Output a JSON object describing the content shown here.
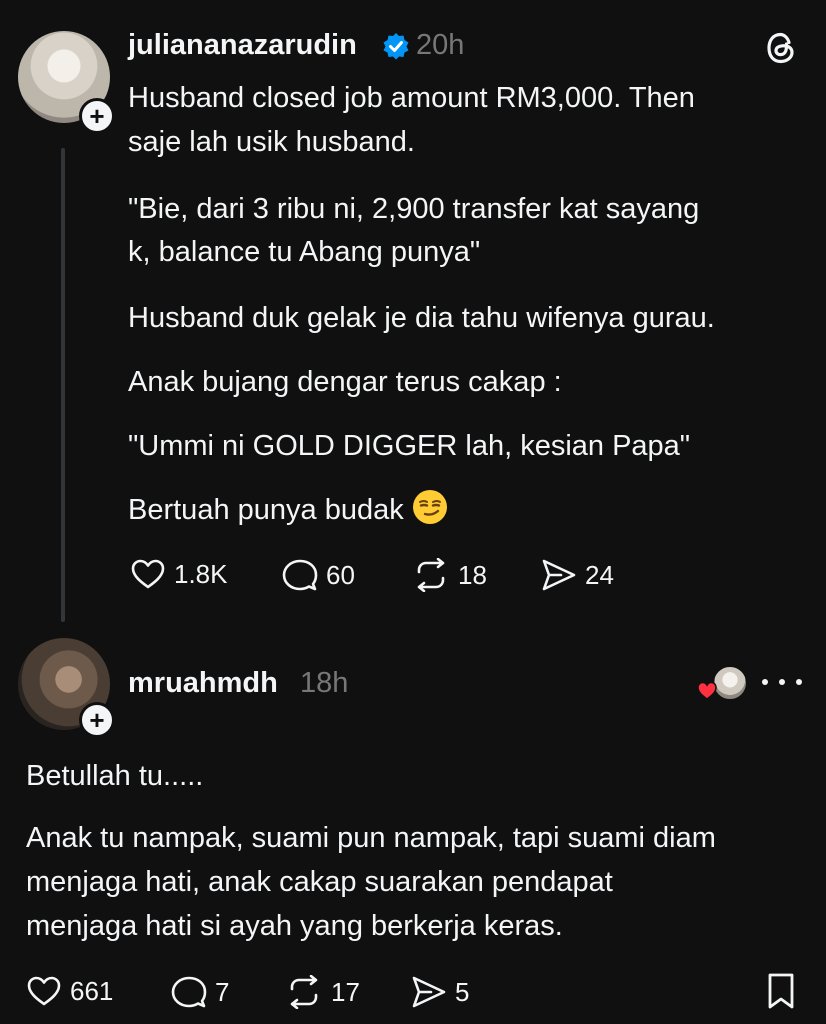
{
  "post": {
    "username": "juliananazarudin",
    "time": "20h",
    "lines": [
      "Husband closed job amount RM3,000. Then",
      "saje lah usik husband.",
      "\"Bie, dari 3 ribu ni, 2,900 transfer kat sayang",
      "k, balance tu Abang punya\"",
      "Husband duk gelak je dia tahu wifenya gurau.",
      "Anak bujang dengar terus cakap :",
      "\"Ummi ni GOLD DIGGER lah, kesian Papa\"",
      "Bertuah punya budak"
    ],
    "emoji": "smirking-face",
    "likes": "1.8K",
    "comments": "60",
    "reposts": "18",
    "shares": "24"
  },
  "reply": {
    "username": "mruahmdh",
    "time": "18h",
    "lines": [
      "Betullah tu.....",
      "Anak tu nampak, suami pun nampak, tapi suami diam",
      "menjaga hati, anak cakap suarakan pendapat",
      "menjaga hati si ayah yang berkerja keras."
    ],
    "likes": "661",
    "comments": "7",
    "reposts": "17",
    "shares": "5"
  },
  "icons": {
    "verified": "verified-badge-icon",
    "logo": "threads-logo-icon",
    "like": "heart-icon",
    "comment": "comment-icon",
    "repost": "repost-icon",
    "share": "share-icon",
    "bookmark": "bookmark-icon",
    "more": "more-dots-icon"
  },
  "colors": {
    "background": "#101010",
    "text": "#f3f5f7",
    "muted": "#777777",
    "verified": "#0095f6",
    "liked_heart": "#ff3040"
  }
}
